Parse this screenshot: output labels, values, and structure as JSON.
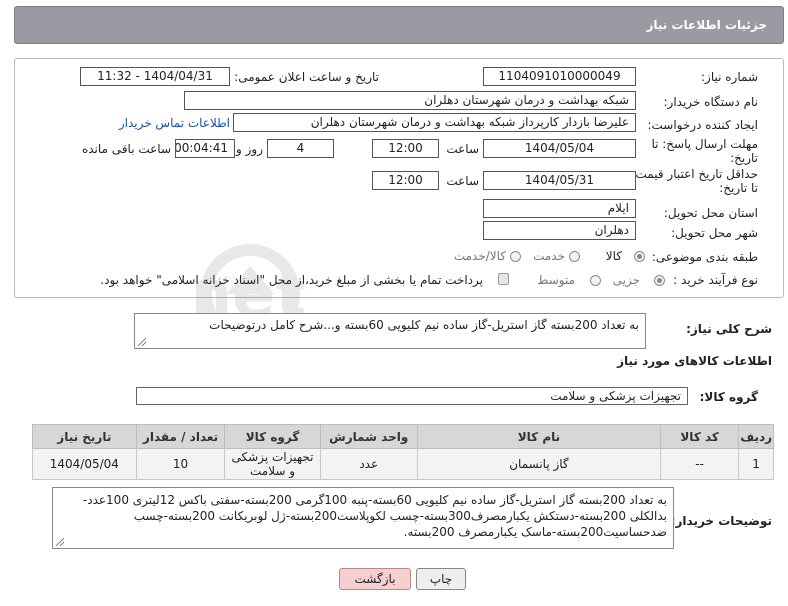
{
  "header": {
    "title": "جزئیات اطلاعات نیاز"
  },
  "form": {
    "need_number_label": "شماره نیاز:",
    "need_number": "1104091010000049",
    "announce_label": "تاریخ و ساعت اعلان عمومی:",
    "announce_value": "1404/04/31 - 11:32",
    "buyer_org_label": "نام دستگاه خریدار:",
    "buyer_org": "شبکه بهداشت و درمان شهرستان دهلران",
    "requester_label": "ایجاد کننده درخواست:",
    "requester": "علیرضا بازدار کارپرداز شبکه بهداشت و درمان شهرستان دهلران",
    "contact_link": "اطلاعات تماس خریدار",
    "deadline_label_1": "مهلت ارسال پاسخ: تا",
    "deadline_label_2": "تاریخ:",
    "deadline_date": "1404/05/04",
    "time_label": "ساعت",
    "deadline_time": "12:00",
    "days_value": "4",
    "days_label": "روز و",
    "remaining_time": "00:04:41",
    "remaining_label": "ساعت باقی مانده",
    "price_validity_label_1": "حداقل تاریخ اعتبار قیمت:",
    "price_validity_label_2": "تا تاریخ:",
    "price_validity_date": "1404/05/31",
    "price_validity_time": "12:00",
    "province_label": "استان محل تحویل:",
    "province": "ایلام",
    "city_label": "شهر محل تحویل:",
    "city": "دهلران",
    "category_label": "طبقه بندی موضوعی:",
    "category_options": [
      "کالا",
      "خدمت",
      "کالا/خدمت"
    ],
    "category_selected": "کالا",
    "process_label": "نوع فرآیند خرید :",
    "process_options": [
      "جزیی",
      "متوسط"
    ],
    "process_selected": "جزیی",
    "payment_note": "پرداخت تمام یا بخشی از مبلغ خرید،از محل \"اسناد خزانه اسلامی\" خواهد بود."
  },
  "general_desc": {
    "label": "شرح کلی نیاز:",
    "value": "به تعداد 200بسته گاز استریل-گاز ساده نیم کلیویی 60بسته و...شرح کامل درتوضیحات"
  },
  "goods_section": {
    "title": "اطلاعات کالاهای مورد نیاز",
    "group_label": "گروه کالا:",
    "group_value": "تجهیزات پزشکی و سلامت"
  },
  "table": {
    "headers": [
      "ردیف",
      "کد کالا",
      "نام کالا",
      "واحد شمارش",
      "گروه کالا",
      "تعداد / مقدار",
      "تاریخ نیاز"
    ],
    "rows": [
      [
        "1",
        "--",
        "گاز پانسمان",
        "عدد",
        "تجهیزات پزشکی و سلامت",
        "10",
        "1404/05/04"
      ]
    ]
  },
  "buyer_notes": {
    "label": "توضیحات خریدار:",
    "value": "به تعداد 200بسته گاز استریل-گاز ساده نیم کلیویی 60بسته-پنبه 100گرمی 200بسته-سفتی باکس 12لیتری 100عدد-بدالکلی 200بسته-دستکش یکبارمصرف300بسته-چسب لکوپلاست200بسته-ژل لوبریکانت 200بسته-چسب ضدحساسیت200بسته-ماسک یکبارمصرف 200بسته."
  },
  "buttons": {
    "print": "چاپ",
    "back": "بازگشت"
  },
  "watermark": {
    "text": "AriaTender.net"
  },
  "colors": {
    "header_bg": "#9a9aa3",
    "link": "#1a4fb8",
    "back_button": "#f6d0d0"
  }
}
